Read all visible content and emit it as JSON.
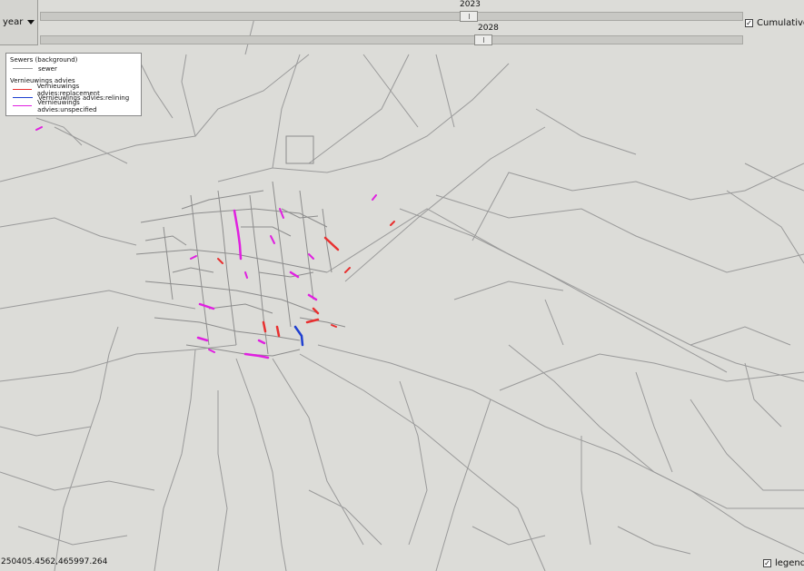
{
  "controls": {
    "year_label": "year",
    "slider_top_value": "2023",
    "slider_top_fraction": 0.61,
    "slider_bottom_value": "2028",
    "slider_bottom_fraction": 0.63,
    "cumulative_label": "Cumulative",
    "cumulative_checked": true
  },
  "legend": {
    "background_title": "Sewers (background)",
    "background_item": "sewer",
    "advice_title": "Vernieuwings advies",
    "items": [
      {
        "label": "Vernieuwings advies:replacement",
        "color": "#e83030"
      },
      {
        "label": "Vernieuwings advies:relining",
        "color": "#2040d0"
      },
      {
        "label": "Vernieuwings advies:unspecified",
        "color": "#e020e0"
      }
    ],
    "sewer_color": "#9a9a9a"
  },
  "status": {
    "coordinates": "250405.4562,465997.264",
    "legend_label": "legend",
    "legend_checked": true
  }
}
